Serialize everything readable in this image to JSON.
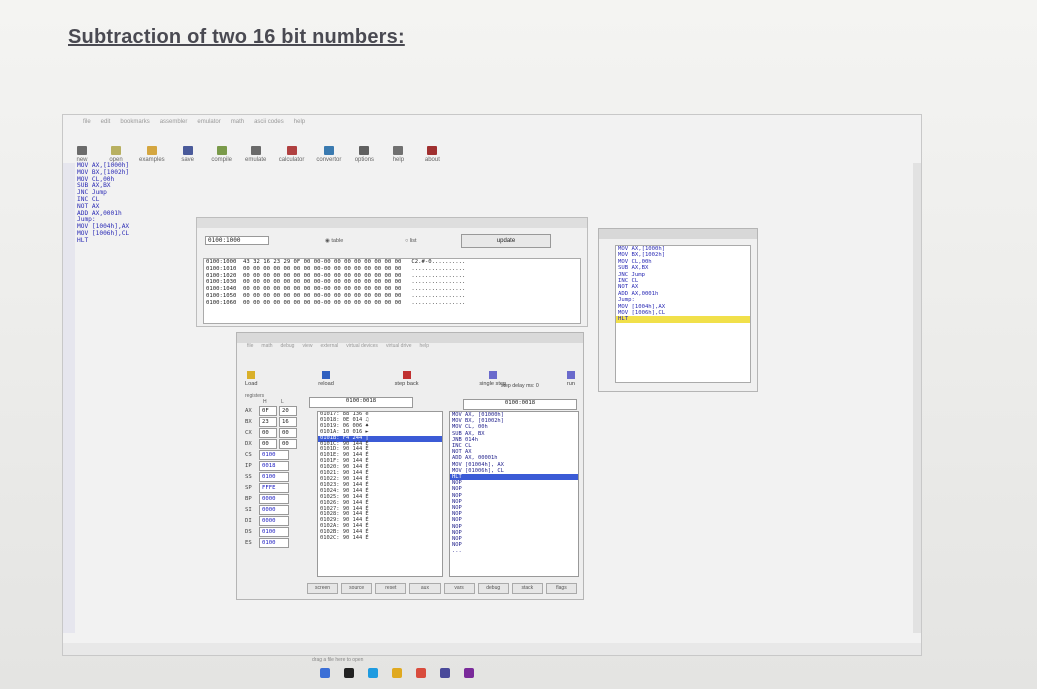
{
  "heading": "Subtraction of two 16 bit numbers:",
  "editor": {
    "menu": [
      "file",
      "edit",
      "bookmarks",
      "assembler",
      "emulator",
      "math",
      "ascii codes",
      "help"
    ],
    "toolbar": [
      {
        "label": "new"
      },
      {
        "label": "open"
      },
      {
        "label": "examples"
      },
      {
        "label": "save"
      },
      {
        "label": "compile"
      },
      {
        "label": "emulate"
      },
      {
        "label": "calculator"
      },
      {
        "label": "convertor"
      },
      {
        "label": "options"
      },
      {
        "label": "help"
      },
      {
        "label": "about"
      }
    ],
    "code": [
      "MOV AX,[1000h]",
      "MOV BX,[1002h]",
      "MOV CL,00h",
      "SUB AX,BX",
      "JNC Jump",
      "INC CL",
      "NOT AX",
      "ADD AX,0001h",
      "Jump:",
      "MOV [1004h],AX",
      "MOV [1006h],CL",
      "HLT"
    ],
    "drop_hint": "drag a file here to open"
  },
  "memory_window": {
    "address": "0100:1000",
    "update_label": "update",
    "radio_table": "table",
    "radio_list": "list",
    "dump": [
      "0100:1000  43 32 16 23 29 0F 00 00-00 00 00 00 00 00 00 00   C2.#-0..........",
      "0100:1010  00 00 00 00 00 00 00 00-00 00 00 00 00 00 00 00   ................",
      "0100:1020  00 00 00 00 00 00 00 00-00 00 00 00 00 00 00 00   ................",
      "0100:1030  00 00 00 00 00 00 00 00-00 00 00 00 00 00 00 00   ................",
      "0100:1040  00 00 00 00 00 00 00 00-00 00 00 00 00 00 00 00   ................",
      "0100:1050  00 00 00 00 00 00 00 00-00 00 00 00 00 00 00 00   ................",
      "0100:1060  00 00 00 00 00 00 00 00-00 00 00 00 00 00 00 00   ................"
    ]
  },
  "emulator": {
    "menu": [
      "file",
      "math",
      "debug",
      "view",
      "external",
      "virtual devices",
      "virtual drive",
      "help"
    ],
    "tools": [
      "Load",
      "reload",
      "step back",
      "single step",
      "run"
    ],
    "step_delay": "step delay ms: 0",
    "registers_label": "registers",
    "h_label": "H",
    "l_label": "L",
    "registers": [
      {
        "name": "AX",
        "h": "0F",
        "l": "20"
      },
      {
        "name": "BX",
        "h": "23",
        "l": "16"
      },
      {
        "name": "CX",
        "h": "00",
        "l": "00"
      },
      {
        "name": "DX",
        "h": "00",
        "l": "00"
      },
      {
        "name": "CS",
        "v": "0100"
      },
      {
        "name": "IP",
        "v": "0018"
      },
      {
        "name": "SS",
        "v": "0100"
      },
      {
        "name": "SP",
        "v": "FFFE"
      },
      {
        "name": "BP",
        "v": "0000"
      },
      {
        "name": "SI",
        "v": "0000"
      },
      {
        "name": "DI",
        "v": "0000"
      },
      {
        "name": "DS",
        "v": "0100"
      },
      {
        "name": "ES",
        "v": "0100"
      }
    ],
    "addr_left": "0100:0018",
    "addr_right": "0100:0018",
    "memlist": [
      "01017: 88 136 ê",
      "01018: 0E 014 ♫",
      "01019: 06 006 ♠",
      "0101A: 10 016 ►",
      "0101B: F4 244 ⌠",
      "0101C: 90 144 É",
      "0101D: 90 144 É",
      "0101E: 90 144 É",
      "0101F: 90 144 É",
      "01020: 90 144 É",
      "01021: 90 144 É",
      "01022: 90 144 É",
      "01023: 90 144 É",
      "01024: 90 144 É",
      "01025: 90 144 É",
      "01026: 90 144 É",
      "01027: 90 144 É",
      "01028: 90 144 É",
      "01029: 90 144 É",
      "0102A: 90 144 É",
      "0102B: 90 144 É",
      "0102C: 90 144 É"
    ],
    "memlist_selected": 4,
    "disasm": [
      "MOV AX, [01000h]",
      "MOV BX, [01002h]",
      "MOV CL, 00h",
      "SUB AX, BX",
      "JNB 014h",
      "INC CL",
      "NOT AX",
      "ADD AX, 00001h",
      "MOV [01004h], AX",
      "MOV [01006h], CL",
      "HLT",
      "NOP",
      "NOP",
      "NOP",
      "NOP",
      "NOP",
      "NOP",
      "NOP",
      "NOP",
      "NOP",
      "NOP",
      "NOP",
      "..."
    ],
    "disasm_selected": 10,
    "bottom_buttons": [
      "screen",
      "source",
      "reset",
      "aux",
      "vars",
      "debug",
      "stack",
      "flags"
    ]
  },
  "source_window": {
    "code": [
      "MOV AX,[1000h]",
      "MOV BX,[1002h]",
      "MOV CL,00h",
      "SUB AX,BX",
      "JNC Jump",
      "INC CL",
      "NOT AX",
      "ADD AX,0001h",
      "Jump:",
      "MOV [1004h],AX",
      "MOV [1006h],CL",
      "HLT"
    ],
    "current_line": 11
  }
}
